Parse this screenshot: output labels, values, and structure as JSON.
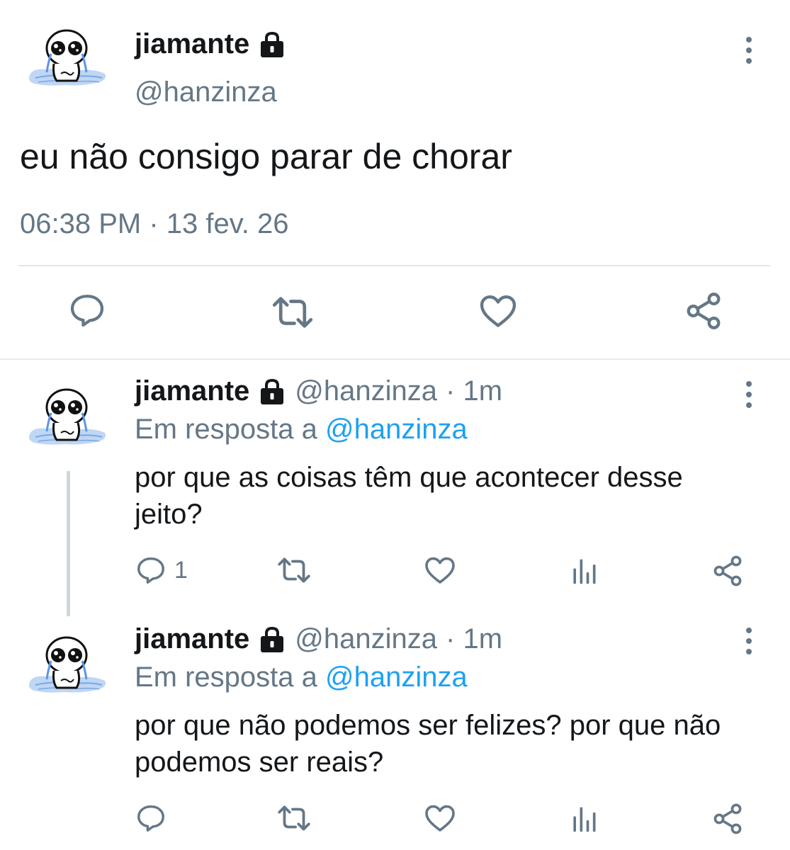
{
  "main_tweet": {
    "name": "jiamante",
    "handle": "@hanzinza",
    "text": "eu não consigo parar de chorar",
    "timestamp": "06:38 PM · 13 fev. 26",
    "icons": [
      "lock-icon",
      "reply-icon",
      "retweet-icon",
      "like-icon",
      "share-icon",
      "more-icon"
    ]
  },
  "replies": [
    {
      "name": "jiamante",
      "handle": "@hanzinza",
      "time": "· 1m",
      "reply_prefix": "Em resposta a",
      "reply_to": "@hanzinza",
      "text": "por que as coisas têm que acontecer desse jeito?",
      "reply_count": "1"
    },
    {
      "name": "jiamante",
      "handle": "@hanzinza",
      "time": "· 1m",
      "reply_prefix": "Em resposta a",
      "reply_to": "@hanzinza",
      "text": "por que não podemos ser felizes? por que não podemos ser reais?",
      "reply_count": ""
    }
  ],
  "colors": {
    "text": "#14171a",
    "muted": "#657786",
    "accent": "#1da1f2",
    "border": "#e1e8ed"
  }
}
